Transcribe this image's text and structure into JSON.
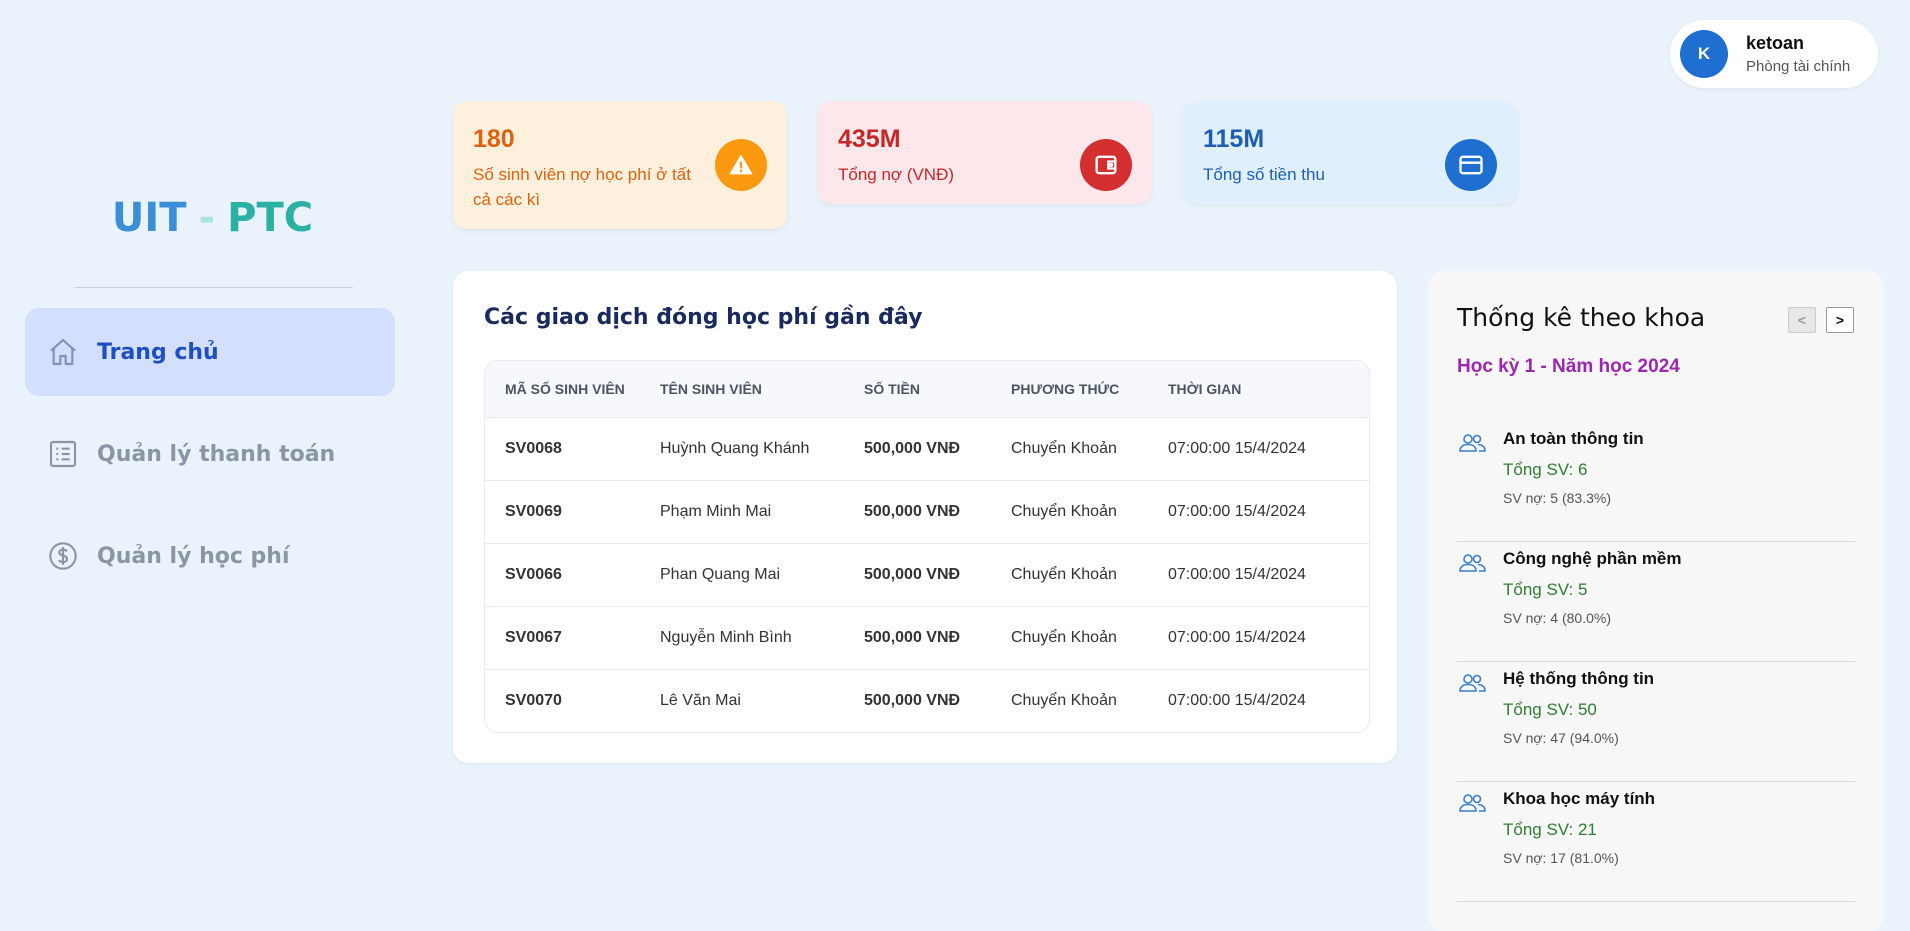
{
  "brand": {
    "part1": "UIT",
    "separator": "-",
    "part2": "PTC"
  },
  "sidebar": {
    "items": [
      {
        "label": "Trang chủ",
        "icon": "home-icon"
      },
      {
        "label": "Quản lý thanh toán",
        "icon": "list-icon"
      },
      {
        "label": "Quản lý học phí",
        "icon": "dollar-icon"
      }
    ]
  },
  "user": {
    "initial": "K",
    "name": "ketoan",
    "role": "Phòng tài chính"
  },
  "stats": [
    {
      "value": "180",
      "label": "Số sinh viên nợ học phí ở tất cả các kì",
      "icon": "warning-icon"
    },
    {
      "value": "435M",
      "label": "Tổng nợ (VNĐ)",
      "icon": "wallet-icon"
    },
    {
      "value": "115M",
      "label": "Tổng số tiền thu",
      "icon": "card-icon"
    }
  ],
  "transactions": {
    "title": "Các giao dịch đóng học phí gần đây",
    "headers": [
      "MÃ SỐ SINH VIÊN",
      "TÊN SINH VIÊN",
      "SỐ TIỀN",
      "PHƯƠNG THỨC",
      "THỜI GIAN"
    ],
    "rows": [
      {
        "id": "SV0068",
        "name": "Huỳnh Quang Khánh",
        "amount": "500,000 VNĐ",
        "method": "Chuyển Khoản",
        "time": "07:00:00 15/4/2024"
      },
      {
        "id": "SV0069",
        "name": "Phạm Minh Mai",
        "amount": "500,000 VNĐ",
        "method": "Chuyển Khoản",
        "time": "07:00:00 15/4/2024"
      },
      {
        "id": "SV0066",
        "name": "Phan Quang Mai",
        "amount": "500,000 VNĐ",
        "method": "Chuyển Khoản",
        "time": "07:00:00 15/4/2024"
      },
      {
        "id": "SV0067",
        "name": "Nguyễn Minh Bình",
        "amount": "500,000 VNĐ",
        "method": "Chuyển Khoản",
        "time": "07:00:00 15/4/2024"
      },
      {
        "id": "SV0070",
        "name": "Lê Văn Mai",
        "amount": "500,000 VNĐ",
        "method": "Chuyển Khoản",
        "time": "07:00:00 15/4/2024"
      }
    ]
  },
  "department_stats": {
    "title": "Thống kê theo khoa",
    "prev_label": "<",
    "next_label": ">",
    "term": "Học kỳ 1 - Năm học 2024",
    "items": [
      {
        "name": "An toàn thông tin",
        "total": "Tổng SV: 6",
        "debt": "SV nợ: 5 (83.3%)"
      },
      {
        "name": "Công nghệ phần mềm",
        "total": "Tổng SV: 5",
        "debt": "SV nợ: 4 (80.0%)"
      },
      {
        "name": "Hệ thống thông tin",
        "total": "Tổng SV: 50",
        "debt": "SV nợ: 47 (94.0%)"
      },
      {
        "name": "Khoa học máy tính",
        "total": "Tổng SV: 21",
        "debt": "SV nợ: 17 (81.0%)"
      }
    ]
  }
}
